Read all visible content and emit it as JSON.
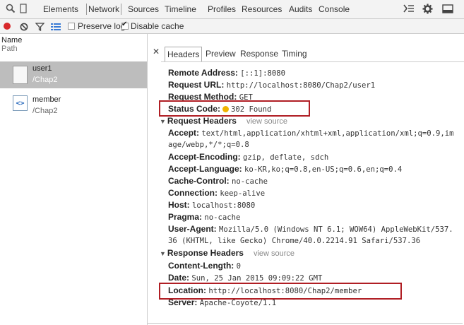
{
  "toolbar": {
    "tabs": [
      "Elements",
      "Network",
      "Sources",
      "Timeline",
      "Profiles",
      "Resources",
      "Audits",
      "Console"
    ]
  },
  "network_toolbar": {
    "preserve_log": "Preserve log",
    "disable_cache": "Disable cache"
  },
  "request_list": {
    "header_name": "Name",
    "header_path": "Path",
    "items": [
      {
        "name": "user1",
        "path": "/Chap2"
      },
      {
        "name": "member",
        "path": "/Chap2"
      }
    ]
  },
  "detail_tabs": [
    "Headers",
    "Preview",
    "Response",
    "Timing"
  ],
  "general": {
    "remote_address_key": "Remote Address:",
    "remote_address_val": "[::1]:8080",
    "request_url_key": "Request URL:",
    "request_url_val": "http://localhost:8080/Chap2/user1",
    "request_method_key": "Request Method:",
    "request_method_val": "GET",
    "status_code_key": "Status Code:",
    "status_code_val": "302 Found"
  },
  "request_headers": {
    "title": "Request Headers",
    "view_source": "view source",
    "accept_key": "Accept:",
    "accept_val": "text/html,application/xhtml+xml,application/xml;q=0.9,im",
    "accept_cont": "age/webp,*/*;q=0.8",
    "accept_encoding_key": "Accept-Encoding:",
    "accept_encoding_val": "gzip, deflate, sdch",
    "accept_language_key": "Accept-Language:",
    "accept_language_val": "ko-KR,ko;q=0.8,en-US;q=0.6,en;q=0.4",
    "cache_control_key": "Cache-Control:",
    "cache_control_val": "no-cache",
    "connection_key": "Connection:",
    "connection_val": "keep-alive",
    "host_key": "Host:",
    "host_val": "localhost:8080",
    "pragma_key": "Pragma:",
    "pragma_val": "no-cache",
    "user_agent_key": "User-Agent:",
    "user_agent_val": "Mozilla/5.0 (Windows NT 6.1; WOW64) AppleWebKit/537.",
    "user_agent_cont": "36 (KHTML, like Gecko) Chrome/40.0.2214.91 Safari/537.36"
  },
  "response_headers": {
    "title": "Response Headers",
    "view_source": "view source",
    "content_length_key": "Content-Length:",
    "content_length_val": "0",
    "date_key": "Date:",
    "date_val": "Sun, 25 Jan 2015 09:09:22 GMT",
    "location_key": "Location:",
    "location_val": "http://localhost:8080/Chap2/member",
    "server_key": "Server:",
    "server_val": "Apache-Coyote/1.1"
  },
  "colors": {
    "highlight": "#b01e24",
    "record": "#d8282a",
    "status_dot": "#f0b400"
  }
}
